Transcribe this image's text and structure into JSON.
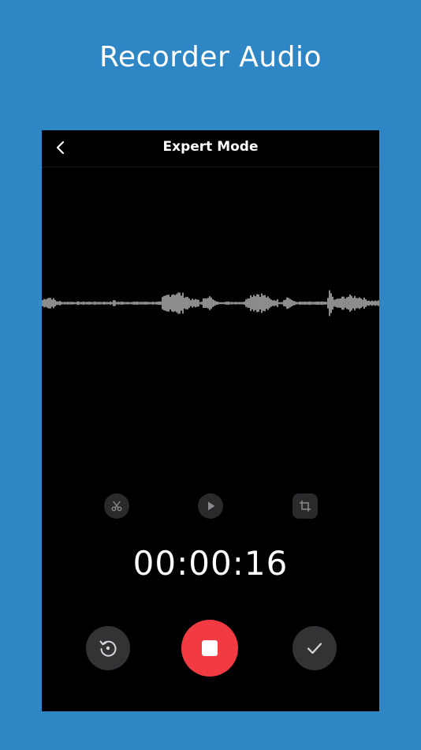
{
  "headline": "Recorder Audio",
  "screen": {
    "title": "Expert Mode",
    "timer": "00:00:16"
  },
  "icons": {
    "back": "chevron-left-icon",
    "trim": "scissors-icon",
    "play": "play-icon",
    "crop": "crop-icon",
    "restart": "restart-icon",
    "stop": "stop-icon",
    "done": "checkmark-icon"
  },
  "colors": {
    "background": "#2f86c5",
    "screen": "#000000",
    "record_button": "#f13a42",
    "control_button": "#333336",
    "tool_button": "#2a2a2c",
    "waveform": "#ffffff"
  }
}
